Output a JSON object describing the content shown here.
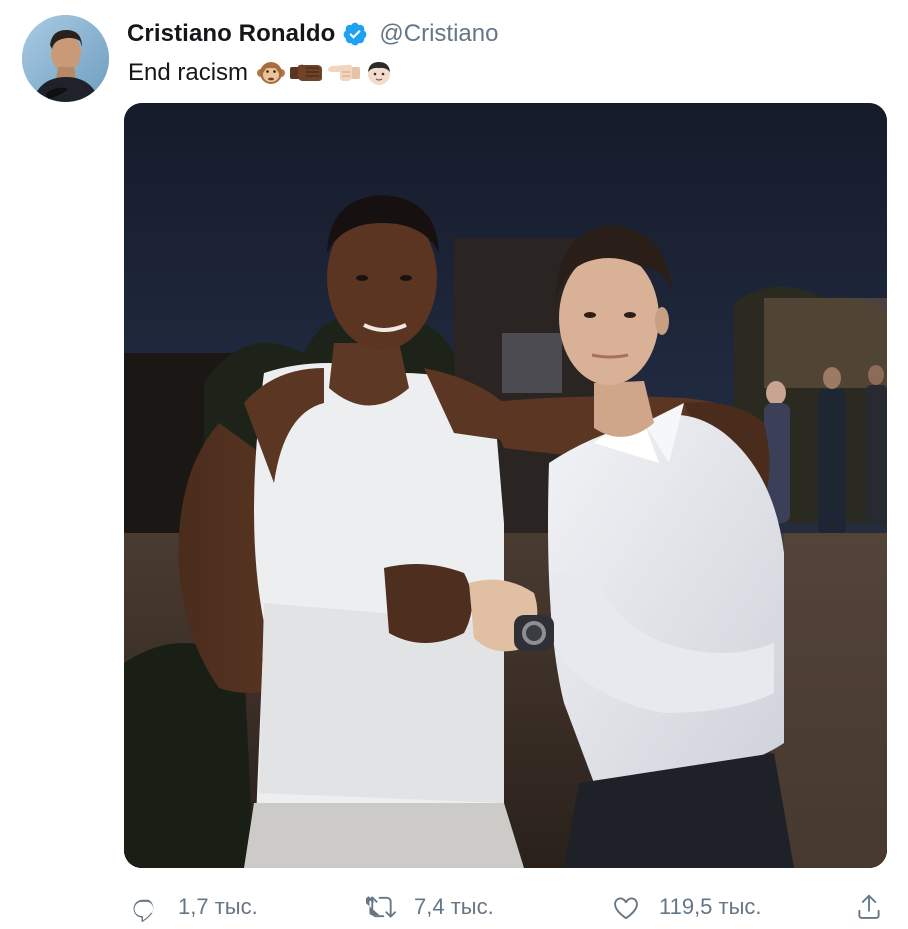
{
  "author": {
    "display_name": "Cristiano Ronaldo",
    "handle": "@Cristiano",
    "verified": true,
    "avatar_icon": "profile-photo"
  },
  "tweet": {
    "text": "End racism",
    "emojis": [
      "monkey-face-emoji",
      "fist-bump-dark-emoji",
      "pointing-hand-light-emoji",
      "boy-face-emoji"
    ]
  },
  "media": {
    "type": "photo",
    "description_icon": "photo"
  },
  "actions": {
    "reply": {
      "icon": "reply-icon",
      "count": "1,7 тыс."
    },
    "retweet": {
      "icon": "retweet-icon",
      "count": "7,4 тыс."
    },
    "like": {
      "icon": "heart-icon",
      "count": "119,5 тыс."
    },
    "share": {
      "icon": "share-icon"
    }
  },
  "colors": {
    "text_primary": "#14171a",
    "text_secondary": "#657786",
    "verified_blue": "#1da1f2"
  }
}
